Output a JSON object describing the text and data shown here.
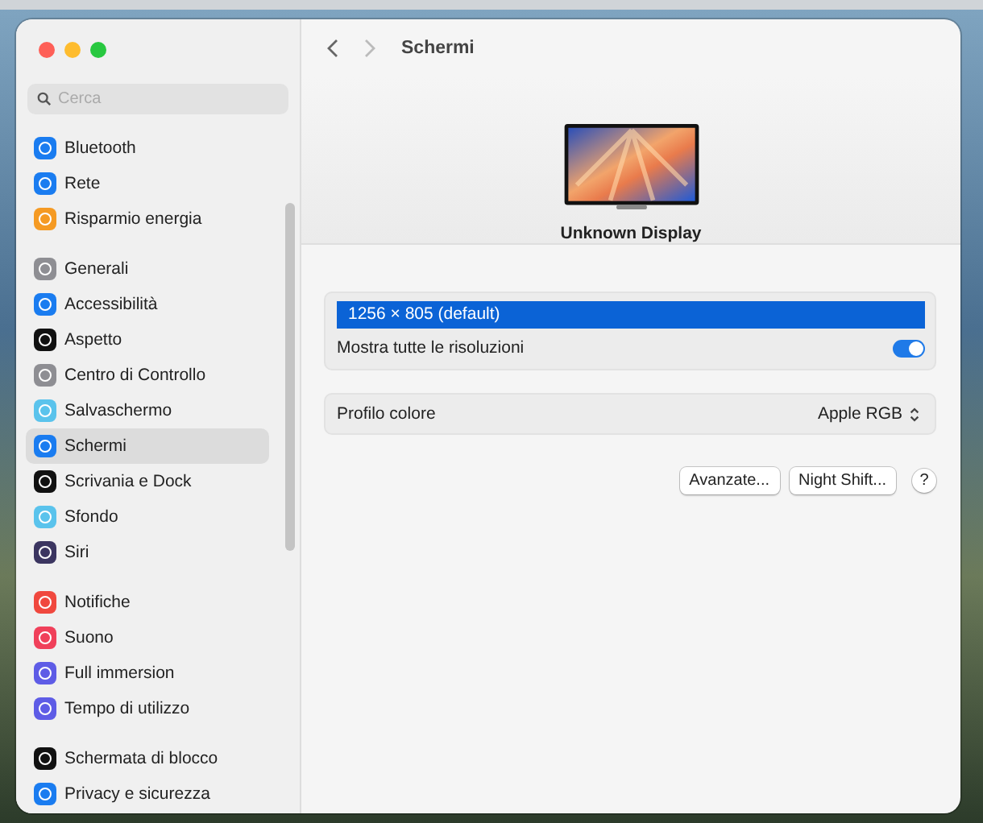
{
  "window": {
    "title": "Schermi"
  },
  "search": {
    "placeholder": "Cerca"
  },
  "sidebar": {
    "groups": [
      {
        "items": [
          {
            "label": "Bluetooth",
            "color": "#1a7cf0",
            "selected": false
          },
          {
            "label": "Rete",
            "color": "#1a7cf0",
            "selected": false
          },
          {
            "label": "Risparmio energia",
            "color": "#f59a23",
            "selected": false
          }
        ]
      },
      {
        "items": [
          {
            "label": "Generali",
            "color": "#8e8e93",
            "selected": false
          },
          {
            "label": "Accessibilità",
            "color": "#1a7cf0",
            "selected": false
          },
          {
            "label": "Aspetto",
            "color": "#111111",
            "selected": false
          },
          {
            "label": "Centro di Controllo",
            "color": "#8e8e93",
            "selected": false
          },
          {
            "label": "Salvaschermo",
            "color": "#5ac3ec",
            "selected": false
          },
          {
            "label": "Schermi",
            "color": "#1a7cf0",
            "selected": true
          },
          {
            "label": "Scrivania e Dock",
            "color": "#111111",
            "selected": false
          },
          {
            "label": "Sfondo",
            "color": "#5ac3ec",
            "selected": false
          },
          {
            "label": "Siri",
            "color": "#3b3560",
            "selected": false
          }
        ]
      },
      {
        "items": [
          {
            "label": "Notifiche",
            "color": "#f0483e",
            "selected": false
          },
          {
            "label": "Suono",
            "color": "#f0405a",
            "selected": false
          },
          {
            "label": "Full immersion",
            "color": "#5e5ce6",
            "selected": false
          },
          {
            "label": "Tempo di utilizzo",
            "color": "#5e5ce6",
            "selected": false
          }
        ]
      },
      {
        "items": [
          {
            "label": "Schermata di blocco",
            "color": "#111111",
            "selected": false
          },
          {
            "label": "Privacy e sicurezza",
            "color": "#1a7cf0",
            "selected": false
          }
        ]
      }
    ]
  },
  "display": {
    "name": "Unknown Display"
  },
  "resolutions": [
    {
      "label": "1256 × 805 (default)",
      "selected": true
    }
  ],
  "show_all": {
    "label": "Mostra tutte le risoluzioni",
    "on": true
  },
  "color_profile": {
    "label": "Profilo colore",
    "value": "Apple RGB"
  },
  "buttons": [
    "Avanzate...",
    "Night Shift..."
  ],
  "help": "?"
}
